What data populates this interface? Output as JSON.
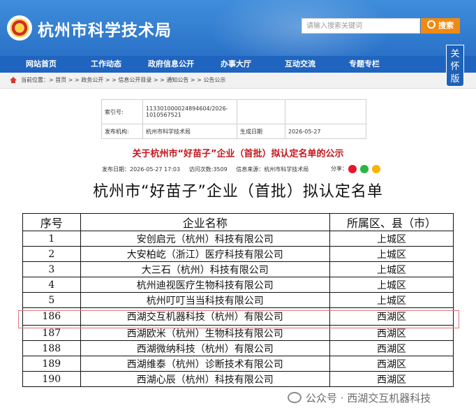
{
  "header": {
    "site_title": "杭州市科学技术局",
    "search_placeholder": "请输入搜索关键词",
    "search_button": "搜索",
    "care_mode": "关怀版"
  },
  "nav": {
    "items": [
      {
        "label": "网站首页"
      },
      {
        "label": "工作动态"
      },
      {
        "label": "政府信息公开"
      },
      {
        "label": "办事大厅"
      },
      {
        "label": "互动交流"
      },
      {
        "label": "专题专栏"
      }
    ]
  },
  "breadcrumb": {
    "text": "当前位置：> 首页 > > 政务公开 > > 信息公开目录 > > 通知公告 > > 公告公示"
  },
  "meta": {
    "index_label": "索引号:",
    "index_value": "113301000024894604/2026-1010567521",
    "issuer_label": "发布机构:",
    "issuer_value": "杭州市科学技术局",
    "date_label": "生成日期",
    "date_value": "2026-05-27"
  },
  "article": {
    "title": "关于杭州市“好苗子”企业（首批）拟认定名单的公示",
    "publish_date": "发布日期：2026-05-27 17:03",
    "visits": "访问次数:3509",
    "source": "信息来源：杭州市科学技术局",
    "share_label": "分享："
  },
  "list": {
    "title": "杭州市“好苗子”企业（首批）拟认定名单",
    "headers": [
      "序号",
      "企业名称",
      "所属区、县（市）"
    ],
    "rows": [
      {
        "no": "1",
        "name": "安创启元（杭州）科技有限公司",
        "district": "上城区"
      },
      {
        "no": "2",
        "name": "大安柏屹（浙江）医疗科技有限公司",
        "district": "上城区"
      },
      {
        "no": "3",
        "name": "大三石（杭州）科技有限公司",
        "district": "上城区"
      },
      {
        "no": "4",
        "name": "杭州迪视医疗生物科技有限公司",
        "district": "上城区"
      },
      {
        "no": "5",
        "name": "杭州叮叮当当科技有限公司",
        "district": "上城区"
      },
      {
        "no": "186",
        "name": "西湖交互机器科技（杭州）有限公司",
        "district": "西湖区"
      },
      {
        "no": "187",
        "name": "西湖欧米（杭州）生物科技有限公司",
        "district": "西湖区"
      },
      {
        "no": "188",
        "name": "西湖微纳科技（杭州）有限公司",
        "district": "西湖区"
      },
      {
        "no": "189",
        "name": "西湖维泰（杭州）诊断技术有限公司",
        "district": "西湖区"
      },
      {
        "no": "190",
        "name": "西湖心辰（杭州）科技有限公司",
        "district": "西湖区"
      }
    ]
  },
  "watermark": "公众号 · 西湖交互机器科技",
  "colors": {
    "header_blue": "#2a72c8",
    "nav_blue": "#1f64be",
    "title_red": "#c4161c",
    "search_orange": "#f08a12",
    "highlight_border": "#e0757a"
  }
}
